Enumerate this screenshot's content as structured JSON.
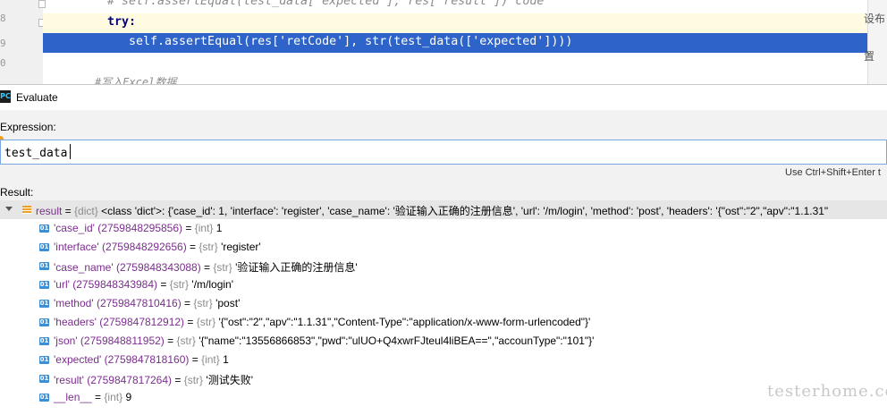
{
  "editor": {
    "line_numbers": [
      "8",
      "9",
      "0"
    ],
    "lines": [
      "# self.assertEqual(test_data['expected'], res['result']) code",
      "try:",
      "self.assertEqual(res['retCode'], str(test_data(['expected'])))",
      "#写入Excel数据"
    ],
    "right_edge_text": [
      "设布",
      "置"
    ]
  },
  "dialog": {
    "title": "Evaluate",
    "app_icon": "PC",
    "expression_label": "Expression:",
    "expression_value": "test_data",
    "hint": "Use Ctrl+Shift+Enter t",
    "result_label": "Result:"
  },
  "result": {
    "root": {
      "name": "result",
      "type": "{dict}",
      "value": "<class 'dict'>: {'case_id': 1, 'interface': 'register', 'case_name': '验证输入正确的注册信息', 'url': '/m/login', 'method': 'post', 'headers': '{\"ost\":\"2\",\"apv\":\"1.1.31\""
    },
    "children": [
      {
        "name": "'case_id' (2759848295856)",
        "type": "{int}",
        "value": "1"
      },
      {
        "name": "'interface' (2759848292656)",
        "type": "{str}",
        "value": "'register'"
      },
      {
        "name": "'case_name' (2759848343088)",
        "type": "{str}",
        "value": "'验证输入正确的注册信息'"
      },
      {
        "name": "'url' (2759848343984)",
        "type": "{str}",
        "value": "'/m/login'"
      },
      {
        "name": "'method' (2759847810416)",
        "type": "{str}",
        "value": "'post'"
      },
      {
        "name": "'headers' (2759847812912)",
        "type": "{str}",
        "value": "'{\"ost\":\"2\",\"apv\":\"1.1.31\",\"Content-Type\":\"application/x-www-form-urlencoded\"}'"
      },
      {
        "name": "'json' (2759848811952)",
        "type": "{str}",
        "value": "'{\"name\":\"13556866853\",\"pwd\":\"ulUO+Q4xwrFJteul4liBEA==\",\"accounType\":\"101\"}'"
      },
      {
        "name": "'expected' (2759847818160)",
        "type": "{int}",
        "value": "1"
      },
      {
        "name": "'result' (2759847817264)",
        "type": "{str}",
        "value": "'测试失败'"
      },
      {
        "name": "__len__",
        "type": "{int}",
        "value": "9"
      }
    ],
    "badge_label": "01"
  },
  "watermark": "testerhome.com"
}
